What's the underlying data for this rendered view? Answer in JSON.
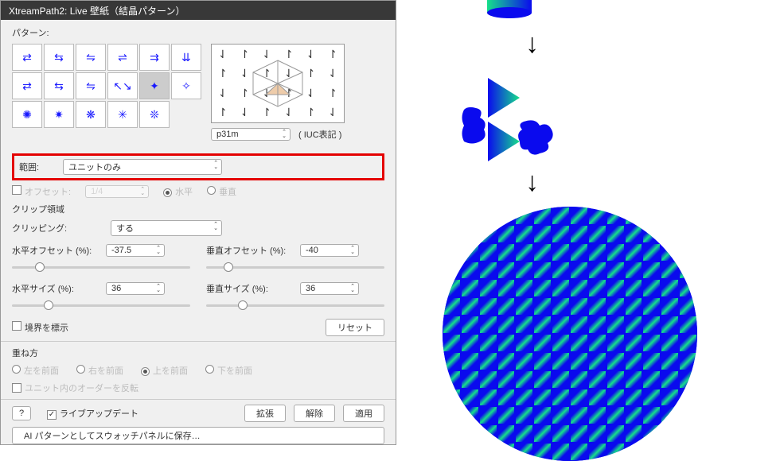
{
  "header": {
    "title": "XtreamPath2: Live 壁紙（結晶パターン）"
  },
  "pattern": {
    "label": "パターン:",
    "iuc_value": "p31m",
    "iuc_label": "( IUC表記 )"
  },
  "range": {
    "label": "範囲:",
    "value": "ユニットのみ"
  },
  "offset": {
    "label": "オフセット:",
    "value": "1/4",
    "horiz": "水平",
    "vert": "垂直"
  },
  "clip": {
    "section": "クリップ領域",
    "clipping_label": "クリッピング:",
    "clipping_value": "する",
    "h_offset_label": "水平オフセット (%):",
    "h_offset_value": "-37.5",
    "v_offset_label": "垂直オフセット (%):",
    "v_offset_value": "-40",
    "h_size_label": "水平サイズ (%):",
    "h_size_value": "36",
    "v_size_label": "垂直サイズ (%):",
    "v_size_value": "36",
    "mark_boundary": "境界を標示",
    "reset": "リセット"
  },
  "stack": {
    "section": "重ね方",
    "left_front": "左を前面",
    "right_front": "右を前面",
    "top_front": "上を前面",
    "bottom_front": "下を前面",
    "reverse_order": "ユニット内のオーダーを反転"
  },
  "footer": {
    "help": "?",
    "live_update": "ライブアップデート",
    "expand": "拡張",
    "release": "解除",
    "apply": "適用",
    "save_swatch": "AI パターンとしてスウォッチパネルに保存…"
  }
}
